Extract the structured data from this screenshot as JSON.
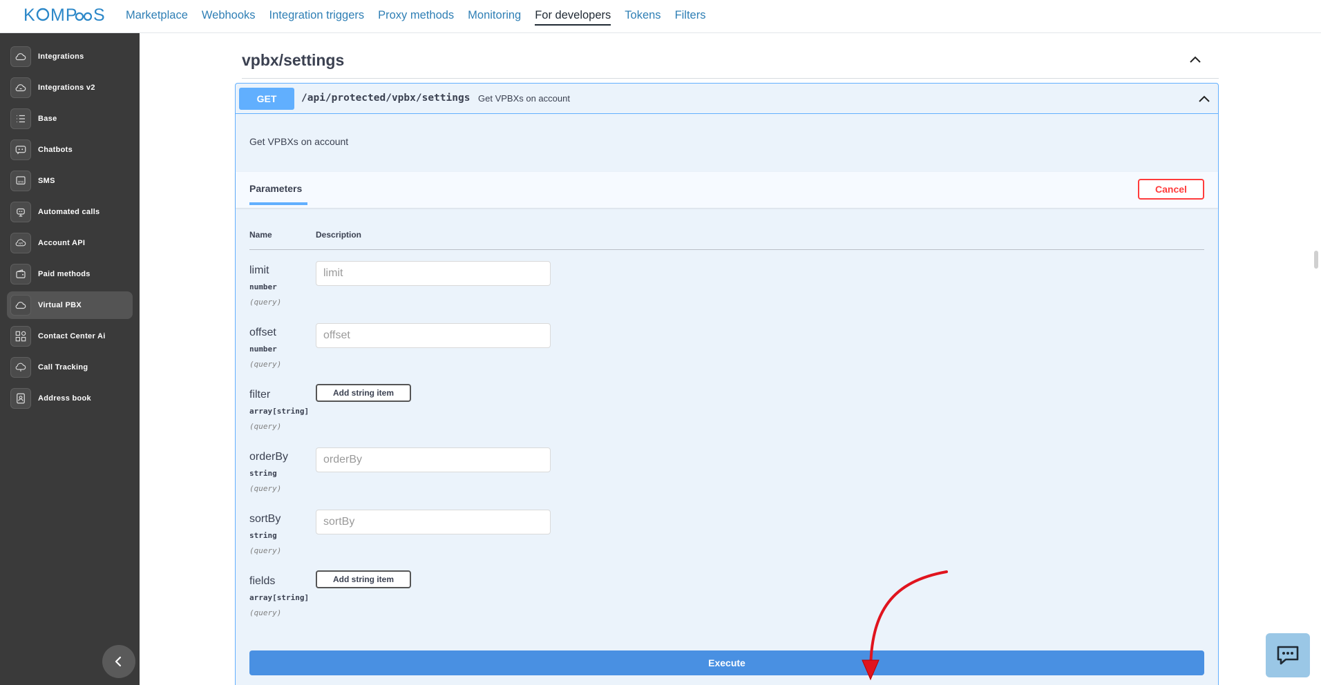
{
  "brand": {
    "logo_text": "KOMPaaS"
  },
  "nav": {
    "items": [
      {
        "label": "Marketplace"
      },
      {
        "label": "Webhooks"
      },
      {
        "label": "Integration triggers"
      },
      {
        "label": "Proxy methods"
      },
      {
        "label": "Monitoring"
      },
      {
        "label": "For developers"
      },
      {
        "label": "Tokens"
      },
      {
        "label": "Filters"
      }
    ],
    "active": "For developers"
  },
  "sidebar": {
    "items": [
      {
        "label": "Integrations",
        "icon": "cloud-icon"
      },
      {
        "label": "Integrations v2",
        "icon": "cloud-v2-icon"
      },
      {
        "label": "Base",
        "icon": "list-icon"
      },
      {
        "label": "Chatbots",
        "icon": "chatbot-icon"
      },
      {
        "label": "SMS",
        "icon": "sms-icon"
      },
      {
        "label": "Automated calls",
        "icon": "robot-call-icon"
      },
      {
        "label": "Account API",
        "icon": "api-icon"
      },
      {
        "label": "Paid methods",
        "icon": "wallet-icon"
      },
      {
        "label": "Virtual PBX",
        "icon": "cloud-pbx-icon"
      },
      {
        "label": "Contact Center Ai",
        "icon": "contact-center-icon"
      },
      {
        "label": "Call Tracking",
        "icon": "call-tracking-icon"
      },
      {
        "label": "Address book",
        "icon": "address-book-icon"
      }
    ],
    "active": "Virtual PBX"
  },
  "section": {
    "title": "vpbx/settings"
  },
  "operation": {
    "method": "GET",
    "path": "/api/protected/vpbx/settings",
    "summary": "Get VPBXs on account",
    "description": "Get VPBXs on account"
  },
  "parameters": {
    "tab_label": "Parameters",
    "cancel_label": "Cancel",
    "col_name": "Name",
    "col_description": "Description",
    "add_item_label": "Add string item",
    "rows": [
      {
        "name": "limit",
        "type": "number",
        "in": "(query)",
        "placeholder": "limit"
      },
      {
        "name": "offset",
        "type": "number",
        "in": "(query)",
        "placeholder": "offset"
      },
      {
        "name": "filter",
        "type": "array[string]",
        "in": "(query)"
      },
      {
        "name": "orderBy",
        "type": "string",
        "in": "(query)",
        "placeholder": "orderBy"
      },
      {
        "name": "sortBy",
        "type": "string",
        "in": "(query)",
        "placeholder": "sortBy"
      },
      {
        "name": "fields",
        "type": "array[string]",
        "in": "(query)"
      }
    ]
  },
  "execute_label": "Execute",
  "colors": {
    "get_blue": "#61affe",
    "execute_blue": "#4990e2",
    "cancel_red": "#ff3b3b",
    "sidebar_bg": "#3a3a3a",
    "annotation_arrow": "#e0141e"
  }
}
